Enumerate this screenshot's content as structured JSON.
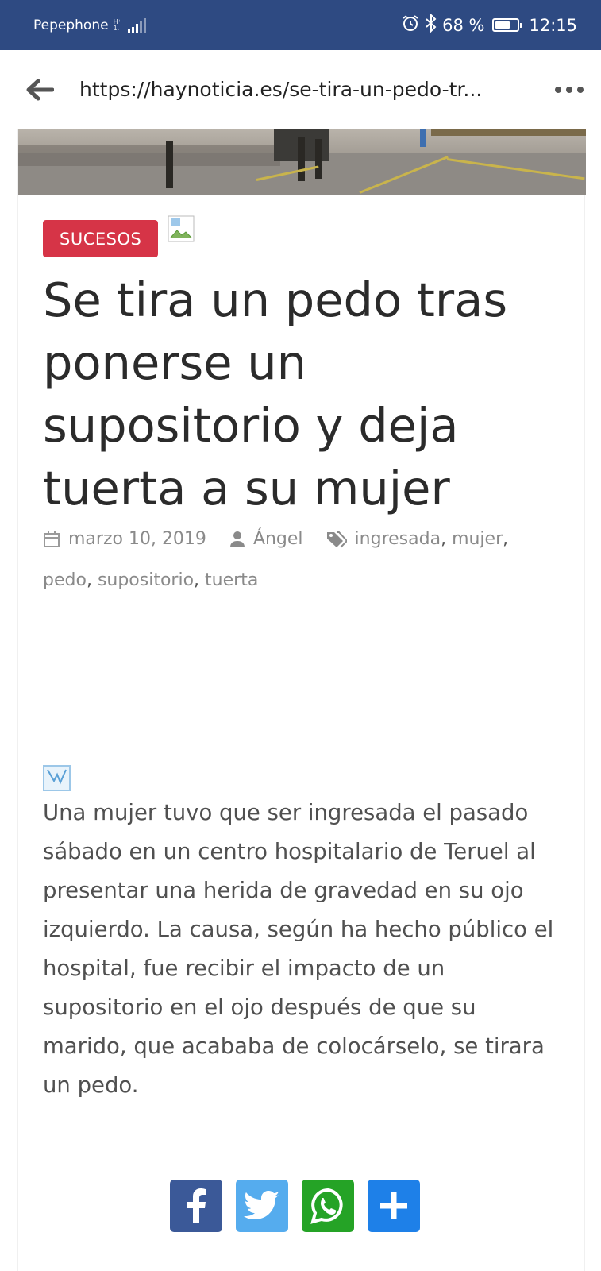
{
  "status_bar": {
    "carrier": "Pepephone",
    "network_top": "H⁺",
    "network_bottom": "1.",
    "battery_percent": "68 %",
    "battery_level": 0.68,
    "time": "12:15",
    "icons": [
      "alarm-icon",
      "bluetooth-icon",
      "battery-icon"
    ]
  },
  "browser": {
    "url": "https://haynoticia.es/se-tira-un-pedo-tr...",
    "back_icon": "arrow-left-icon",
    "menu_icon": "more-dots-icon"
  },
  "article": {
    "category": "SUCESOS",
    "title": "Se tira un pedo tras ponerse un supositorio y deja tuerta a su mujer",
    "date": "marzo 10, 2019",
    "author": "Ángel",
    "tags": [
      "ingresada",
      "mujer",
      "pedo",
      "supositorio",
      "tuerta"
    ],
    "body": "Una mujer tuvo que ser ingresada el pasado sábado en un centro hospitalario de Teruel al presentar una herida de gravedad en su ojo izquierdo. La causa, según ha hecho público el hospital, fue recibir el impacto de un supositorio en el ojo después de que su marido, que acababa de colocárselo, se tirara un pedo."
  },
  "share": {
    "buttons": [
      "facebook",
      "twitter",
      "whatsapp",
      "share-more"
    ],
    "colors": {
      "facebook": "#3b5998",
      "twitter": "#55acee",
      "whatsapp": "#25a326",
      "more": "#1e80e8"
    }
  },
  "colors": {
    "status_bar": "#2e4a82",
    "category_badge": "#d63447"
  }
}
